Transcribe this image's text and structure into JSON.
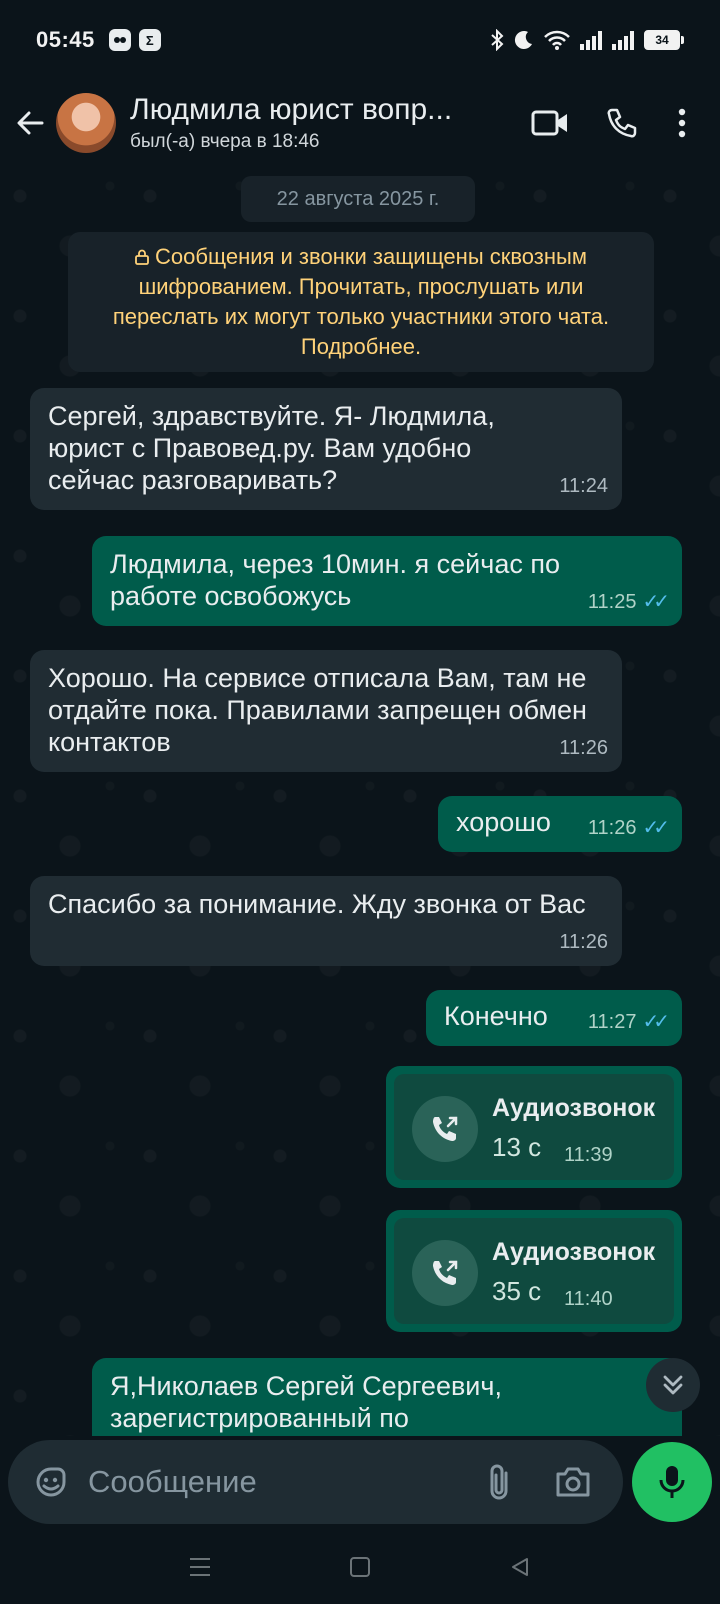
{
  "status_bar": {
    "time": "05:45",
    "battery": "34",
    "icons": [
      "record-icon",
      "sigma-icon",
      "bluetooth-icon",
      "moon-icon",
      "wifi-icon",
      "signal-icon",
      "signal-icon",
      "battery-icon"
    ]
  },
  "header": {
    "contact_name": "Людмила юрист вопр...",
    "last_seen": "был(-а) вчера в 18:46",
    "icons": [
      "back-arrow-icon",
      "video-call-icon",
      "phone-icon",
      "more-vertical-icon"
    ]
  },
  "chat": {
    "date_chip": "22 августа 2025 г.",
    "encryption_notice": "Сообщения и звонки защищены сквозным шифрованием. Прочитать, прослушать или переслать их могут только участники этого чата. Подробнее.",
    "messages": [
      {
        "dir": "in",
        "text": "Сергей, здравствуйте. Я- Людмила, юрист с Правовед.ру. Вам удобно сейчас разговаривать?",
        "time": "11:24"
      },
      {
        "dir": "out",
        "text": "Людмила, через 10мин. я сейчас по работе освобожусь",
        "time": "11:25",
        "read": true
      },
      {
        "dir": "in",
        "text": "Хорошо. На сервисе отписала Вам, там не отдайте пока. Правилами запрещен обмен контактов",
        "time": "11:26"
      },
      {
        "dir": "out",
        "text": "хорошо",
        "time": "11:26",
        "read": true
      },
      {
        "dir": "in",
        "text": "Спасибо за понимание. Жду звонка от Вас",
        "time": "11:26"
      },
      {
        "dir": "out",
        "text": "Конечно",
        "time": "11:27",
        "read": true
      },
      {
        "dir": "out",
        "text": "Я,Николаев Сергей Сергеевич, зарегистрированный по",
        "time": ""
      }
    ],
    "calls": [
      {
        "title": "Аудиозвонок",
        "duration": "13 с",
        "time": "11:39"
      },
      {
        "title": "Аудиозвонок",
        "duration": "35 с",
        "time": "11:40"
      }
    ],
    "read_ticks": "✓✓"
  },
  "composer": {
    "placeholder": "Сообщение",
    "icons": [
      "emoji-icon",
      "attach-icon",
      "camera-icon",
      "mic-icon"
    ]
  },
  "colors": {
    "background": "#0b141a",
    "incoming_bubble": "#202c33",
    "outgoing_bubble": "#005c4b",
    "notice_text": "#ffd279",
    "accent": "#21c063",
    "read_ticks": "#53bdeb"
  }
}
